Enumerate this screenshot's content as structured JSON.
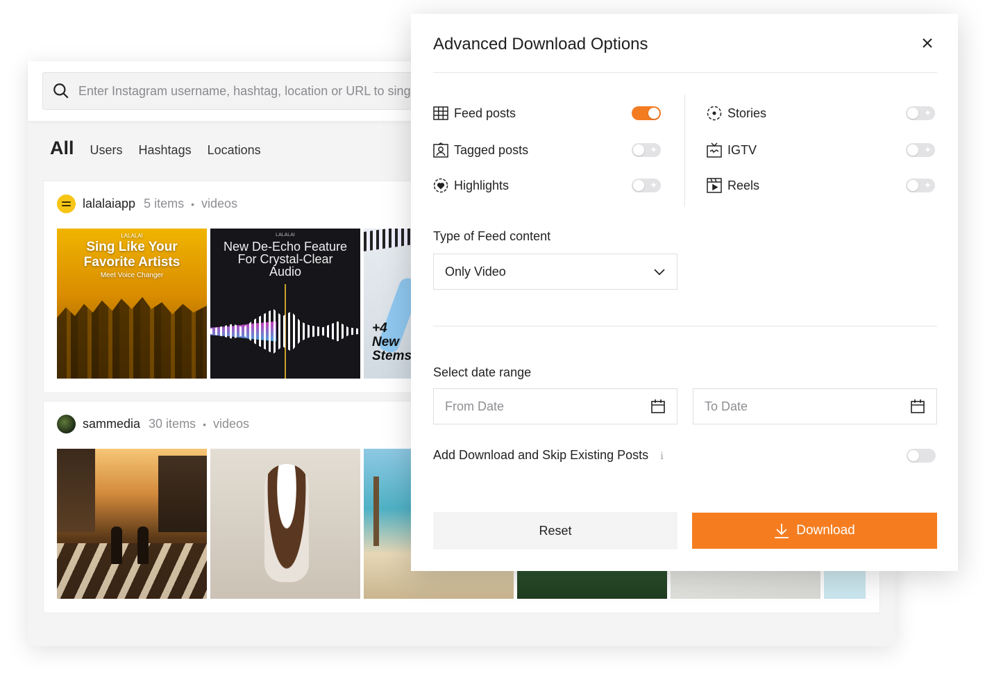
{
  "search": {
    "placeholder": "Enter Instagram username, hashtag, location or URL to single post"
  },
  "filter_tabs": [
    {
      "label": "All",
      "active": true
    },
    {
      "label": "Users"
    },
    {
      "label": "Hashtags"
    },
    {
      "label": "Locations"
    }
  ],
  "results": [
    {
      "username": "lalalaiapp",
      "count": "5 items",
      "separator": "•",
      "type": "videos",
      "thumbs": [
        {
          "brand": "LALALAI",
          "line1": "Sing Like Your",
          "line2": "Favorite Artists",
          "line3": "Meet Voice Changer"
        },
        {
          "brand": "LALALAI",
          "line1": "New De-Echo Feature",
          "line2": "For Crystal-Clear",
          "line3": "Audio"
        },
        {
          "line1": "+4",
          "line2": "New",
          "line3": "Stems"
        }
      ]
    },
    {
      "username": "sammedia",
      "count": "30 items",
      "separator": "•",
      "type": "videos"
    }
  ],
  "modal": {
    "title": "Advanced Download Options",
    "options_left": [
      {
        "label": "Feed posts",
        "icon": "grid-icon",
        "enabled": true
      },
      {
        "label": "Tagged posts",
        "icon": "tagged-person-icon",
        "enabled": false
      },
      {
        "label": "Highlights",
        "icon": "heart-circle-icon",
        "enabled": false
      }
    ],
    "options_right": [
      {
        "label": "Stories",
        "icon": "stories-circle-icon",
        "enabled": false
      },
      {
        "label": "IGTV",
        "icon": "tv-icon",
        "enabled": false
      },
      {
        "label": "Reels",
        "icon": "reels-icon",
        "enabled": false
      }
    ],
    "feed_type": {
      "label": "Type of Feed content",
      "value": "Only Video"
    },
    "date_range": {
      "label": "Select date range",
      "from_placeholder": "From Date",
      "to_placeholder": "To Date"
    },
    "skip_existing": {
      "label": "Add Download and Skip Existing Posts",
      "info": "i",
      "enabled": false
    },
    "reset_label": "Reset",
    "download_label": "Download"
  },
  "colors": {
    "accent": "#f57d20",
    "toggle_off": "#e3e3e5"
  }
}
